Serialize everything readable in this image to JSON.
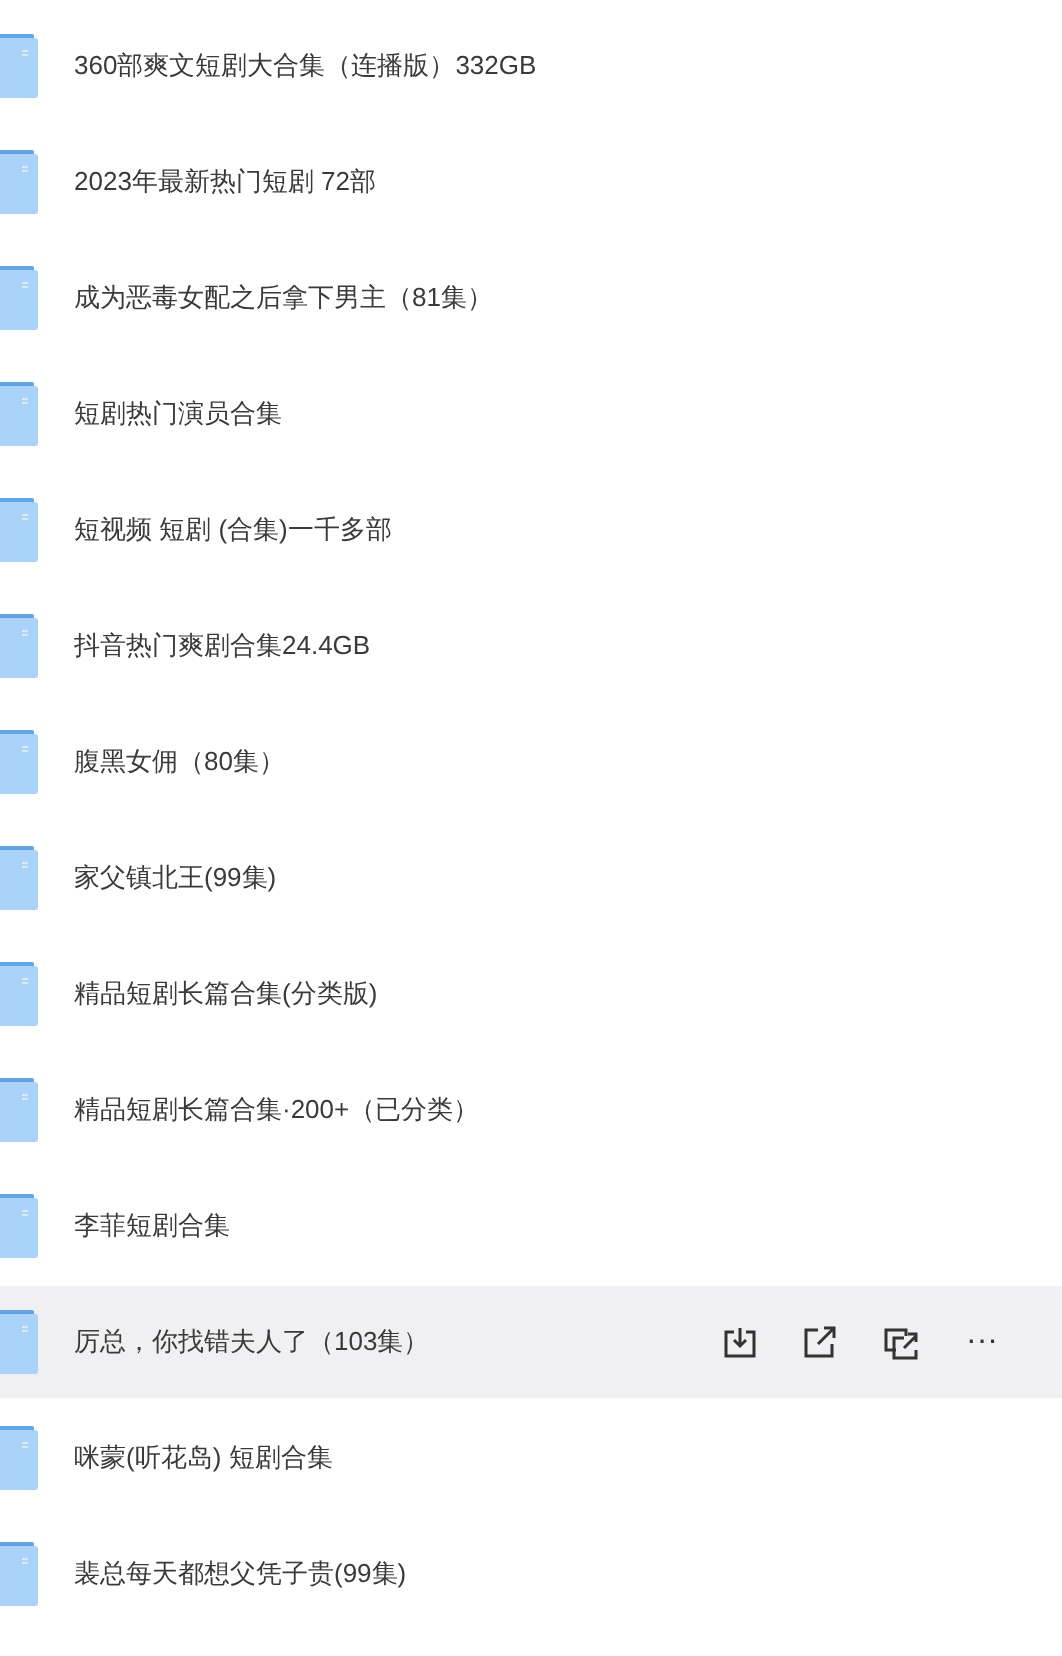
{
  "files": [
    {
      "name": "360部爽文短剧大合集（连播版）332GB",
      "hovered": false
    },
    {
      "name": "2023年最新热门短剧 72部",
      "hovered": false
    },
    {
      "name": "成为恶毒女配之后拿下男主（81集）",
      "hovered": false
    },
    {
      "name": "短剧热门演员合集",
      "hovered": false
    },
    {
      "name": "短视频 短剧 (合集)一千多部",
      "hovered": false
    },
    {
      "name": "抖音热门爽剧合集24.4GB",
      "hovered": false
    },
    {
      "name": "腹黑女佣（80集）",
      "hovered": false
    },
    {
      "name": "家父镇北王(99集)",
      "hovered": false
    },
    {
      "name": "精品短剧长篇合集(分类版)",
      "hovered": false
    },
    {
      "name": "精品短剧长篇合集·200+（已分类）",
      "hovered": false
    },
    {
      "name": "李菲短剧合集",
      "hovered": false
    },
    {
      "name": "厉总，你找错夫人了（103集）",
      "hovered": true
    },
    {
      "name": "咪蒙(听花岛) 短剧合集",
      "hovered": false
    },
    {
      "name": "裴总每天都想父凭子贵(99集)",
      "hovered": false
    }
  ],
  "row_actions": {
    "more": "···"
  }
}
